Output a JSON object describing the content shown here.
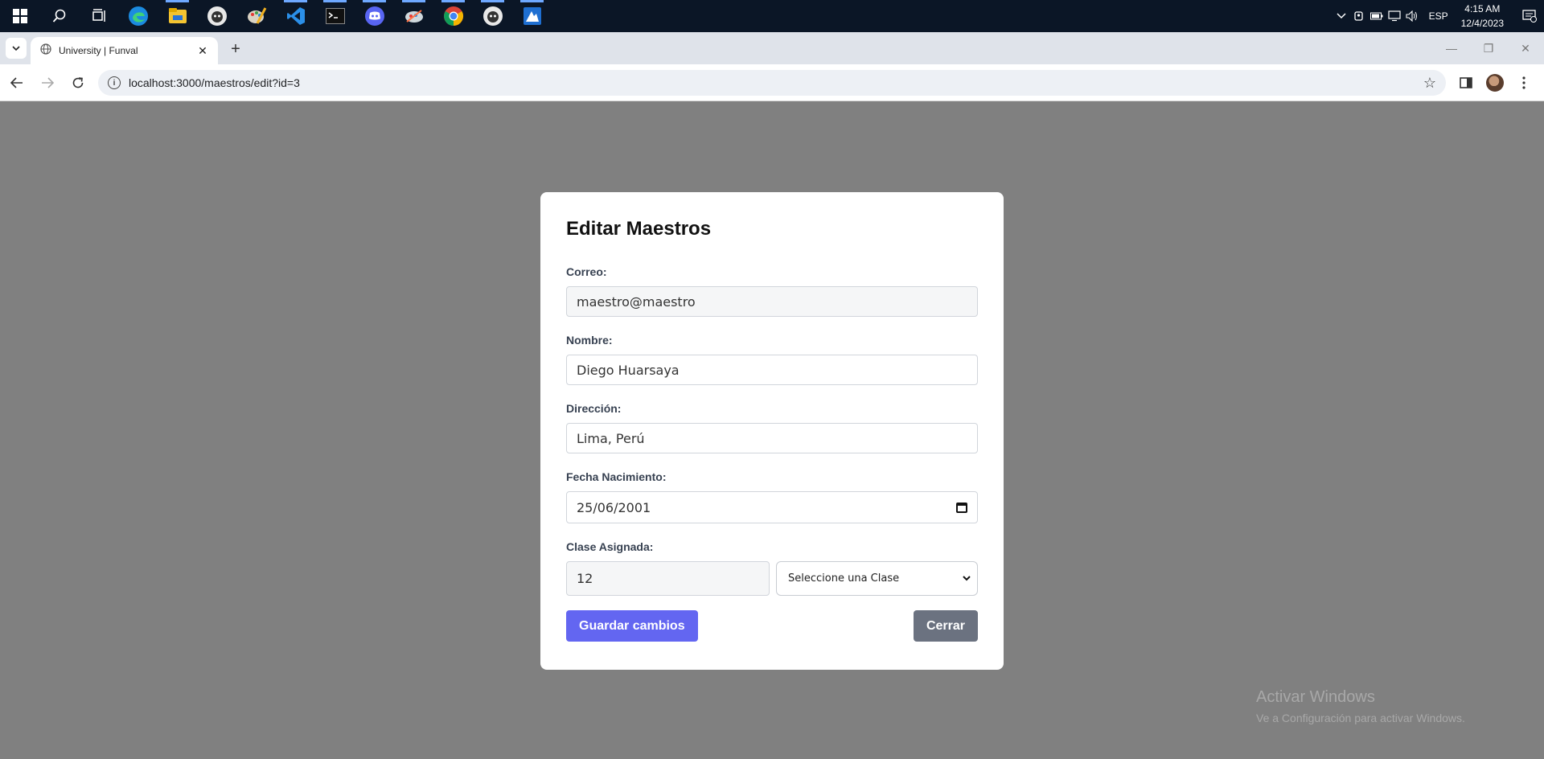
{
  "taskbar": {
    "apps": [
      "start-icon",
      "search-icon",
      "task-view-icon",
      "edge-icon",
      "file-explorer-icon",
      "github-desktop-icon",
      "paint-icon",
      "vscode-icon",
      "terminal-icon",
      "discord-icon",
      "app-icon",
      "chrome-icon",
      "github-desktop-icon-2",
      "azure-data-studio-icon"
    ],
    "language": "ESP",
    "time": "4:15 AM",
    "date": "12/4/2023"
  },
  "browser": {
    "tab_title": "University | Funval",
    "url": "localhost:3000/maestros/edit?id=3"
  },
  "modal": {
    "title": "Editar Maestros",
    "correo_label": "Correo:",
    "correo_value": "maestro@maestro",
    "nombre_label": "Nombre:",
    "nombre_value": "Diego Huarsaya",
    "direccion_label": "Dirección:",
    "direccion_value": "Lima, Perú",
    "fecha_label": "Fecha Nacimiento:",
    "fecha_value": "25/06/2001",
    "clase_label": "Clase Asignada:",
    "clase_value": "12",
    "clase_select_value": "Seleccione una Clase",
    "save_label": "Guardar cambios",
    "close_label": "Cerrar"
  },
  "watermark": {
    "line1": "Activar Windows",
    "line2": "Ve a Configuración para activar Windows."
  },
  "colors": {
    "primary": "#6366f1",
    "secondary": "#6b7280",
    "overlay": "#808080"
  }
}
